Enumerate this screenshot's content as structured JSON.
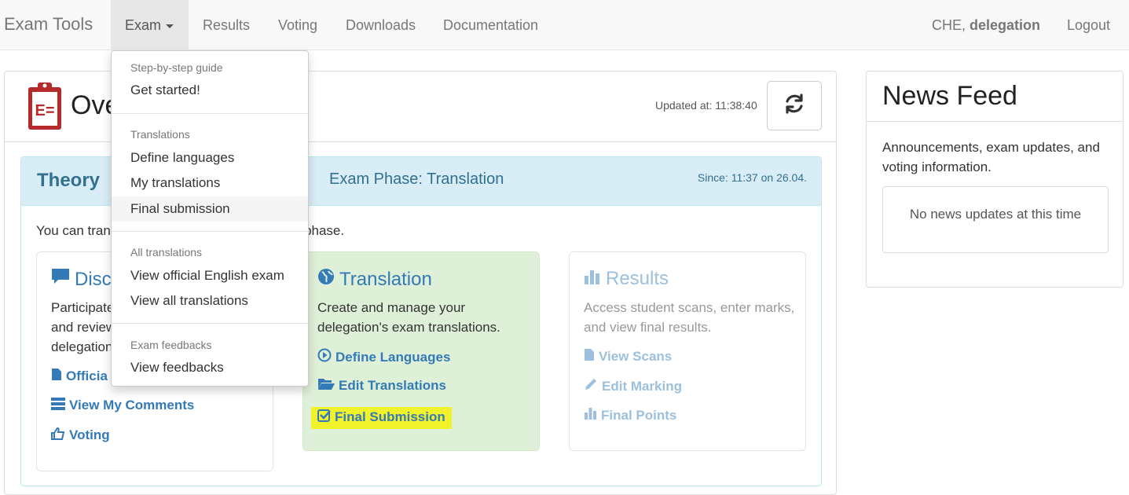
{
  "navbar": {
    "brand": "Exam Tools",
    "items": [
      "Exam",
      "Results",
      "Voting",
      "Downloads",
      "Documentation"
    ],
    "user_country": "CHE,",
    "user_name": "delegation",
    "logout": "Logout"
  },
  "dropdown": {
    "sections": [
      {
        "header": "Step-by-step guide",
        "items": [
          "Get started!"
        ]
      },
      {
        "header": "Translations",
        "items": [
          "Define languages",
          "My translations",
          "Final submission"
        ]
      },
      {
        "header": "All translations",
        "items": [
          "View official English exam",
          "View all translations"
        ]
      },
      {
        "header": "Exam feedbacks",
        "items": [
          "View feedbacks"
        ]
      }
    ],
    "active_item": "Final submission"
  },
  "overview": {
    "title": "Overview",
    "title_visible": "Ove",
    "updated": "Updated at: 11:38:40",
    "icon_color": "#b52a2a"
  },
  "theory": {
    "title": "Theory",
    "phase": "Exam Phase: Translation",
    "since": "Since: 11:37 on 26.04.",
    "intro_left": "You can tran",
    "intro_right": "s phase."
  },
  "cards": {
    "discussion": {
      "title": "Discu",
      "desc_lines": [
        "Participate",
        "and review",
        "delegation"
      ],
      "links": [
        "Officia",
        "View My Comments",
        "Voting"
      ]
    },
    "translation": {
      "title": "Translation",
      "desc": "Create and manage your delegation's exam translations.",
      "links": [
        "Define Languages",
        "Edit Translations",
        "Final Submission"
      ]
    },
    "results": {
      "title": "Results",
      "desc": "Access student scans, enter marks, and view final results.",
      "links": [
        "View Scans",
        "Edit Marking",
        "Final Points"
      ]
    }
  },
  "news": {
    "title": "News Feed",
    "desc": "Announcements, exam updates, and voting information.",
    "empty": "No news updates at this time"
  },
  "colors": {
    "link": "#337ab7",
    "info_text": "#31708f",
    "info_bg": "#d9edf7",
    "success_bg": "#dff0d8",
    "highlight": "#f2f22a"
  }
}
